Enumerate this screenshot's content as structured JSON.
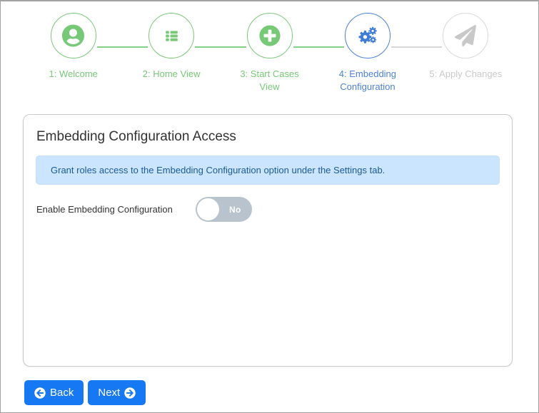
{
  "stepper": {
    "steps": [
      {
        "label": "1: Welcome",
        "icon": "user-circle-icon",
        "state": "completed"
      },
      {
        "label": "2: Home View",
        "icon": "list-icon",
        "state": "completed"
      },
      {
        "label": "3: Start Cases View",
        "icon": "plus-circle-icon",
        "state": "completed"
      },
      {
        "label": "4: Embedding Configuration",
        "icon": "gears-icon",
        "state": "active"
      },
      {
        "label": "5: Apply Changes",
        "icon": "paper-plane-icon",
        "state": "upcoming"
      }
    ],
    "colors": {
      "completed": "#77c877",
      "active": "#4d82d6",
      "upcoming": "#c9c9c9"
    }
  },
  "card": {
    "title": "Embedding Configuration Access",
    "info_alert": "Grant roles access to the Embedding Configuration option under the Settings tab.",
    "toggle": {
      "label": "Enable Embedding Configuration",
      "state_label": "No",
      "enabled": false,
      "off_color": "#b9c3ce"
    },
    "alert_colors": {
      "background": "#cce5ff",
      "text": "#1a5a96"
    }
  },
  "footer": {
    "back_label": "Back",
    "next_label": "Next",
    "button_color": "#1678f2"
  }
}
